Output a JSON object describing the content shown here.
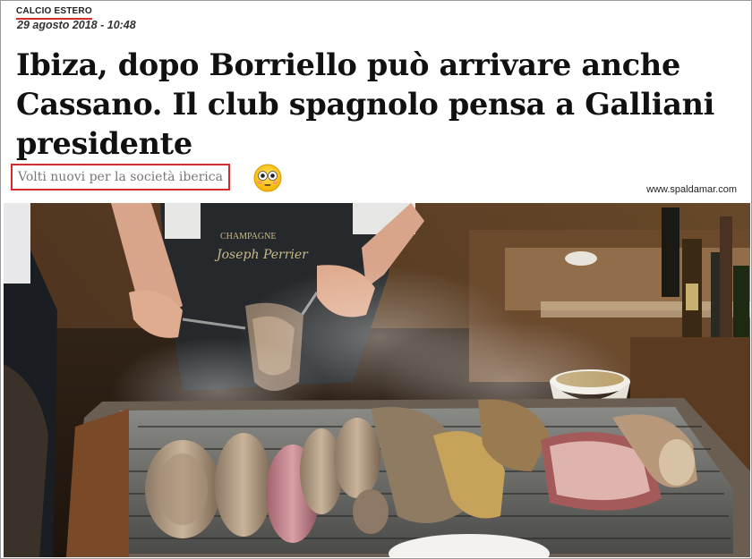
{
  "article": {
    "category": "CALCIO ESTERO",
    "date": "29 agosto 2018 - 10:48",
    "headline": "Ibiza, dopo Borriello può arrivare anche Cassano. Il club spagnolo pensa a Galliani presidente",
    "subtitle": "Volti nuovi per la società iberica",
    "reaction_icon": "flushed-face-emoji",
    "watermark": "www.spaldamar.com"
  },
  "photo": {
    "apron_brand": "CHAMPAGNE",
    "description_icon": "grill-photo"
  },
  "colors": {
    "accent_red": "#d62b2b",
    "headline": "#111111",
    "subtitle": "#777777"
  }
}
